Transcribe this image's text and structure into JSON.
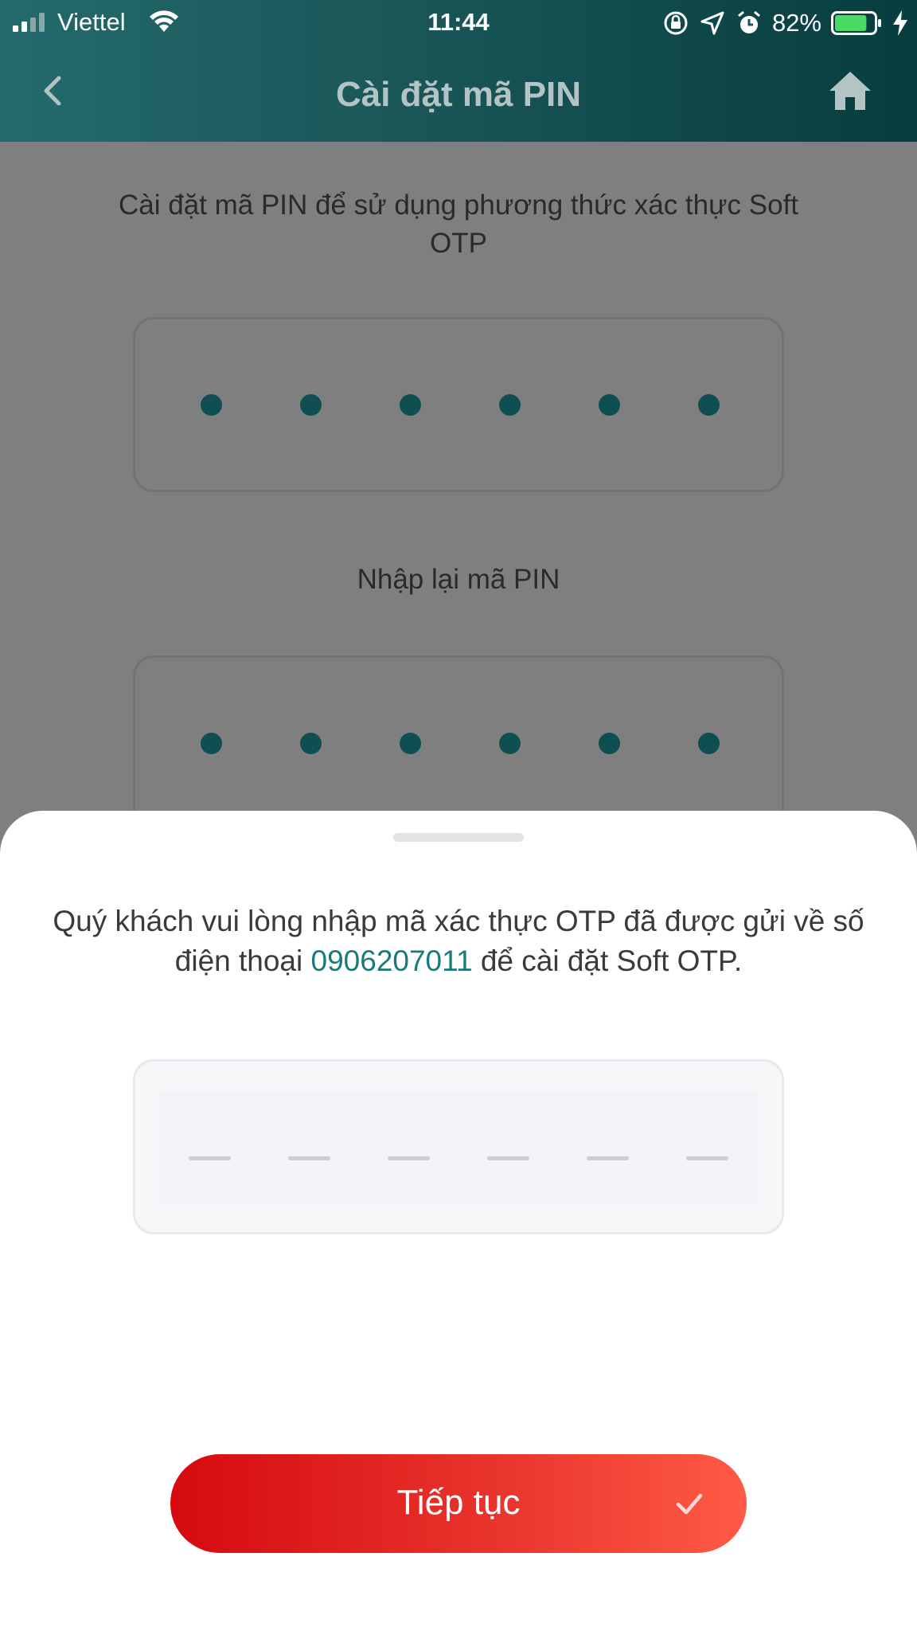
{
  "status_bar": {
    "carrier": "Viettel",
    "time": "11:44",
    "battery": "82%",
    "battery_level": 0.82,
    "icons": [
      "signal-icon",
      "wifi-icon",
      "rotation-lock-icon",
      "location-icon",
      "alarm-icon",
      "battery-icon",
      "charging-icon"
    ]
  },
  "header": {
    "title": "Cài đặt mã PIN",
    "back_icon": "chevron-left-icon",
    "home_icon": "home-icon"
  },
  "background": {
    "intro": "Cài đặt mã PIN để sử dụng phương thức xác thực Soft OTP",
    "pin_dots": 6,
    "reenter_label": "Nhập lại mã PIN",
    "confirm_dots": 6
  },
  "sheet": {
    "message_before": "Quý khách vui lòng nhập mã xác thực OTP đã được gửi về số điện thoại ",
    "phone": "0906207011",
    "message_after": " để cài đặt Soft OTP.",
    "otp_length": 6,
    "continue_label": "Tiếp tục",
    "continue_icon": "check-icon"
  },
  "colors": {
    "header_start": "#246a6c",
    "header_end": "#073d3f",
    "accent": "#1a7a7a",
    "button_start": "#d60a0f",
    "button_end": "#ff5a45"
  }
}
